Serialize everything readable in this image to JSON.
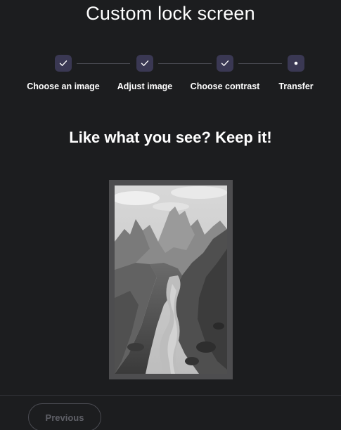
{
  "page": {
    "title": "Custom lock screen",
    "headline": "Like what you see? Keep it!"
  },
  "stepper": {
    "steps": [
      {
        "label": "Choose an image",
        "state": "completed",
        "icon": "check-icon"
      },
      {
        "label": "Adjust image",
        "state": "completed",
        "icon": "check-icon"
      },
      {
        "label": "Choose contrast",
        "state": "completed",
        "icon": "check-icon"
      },
      {
        "label": "Transfer",
        "state": "current",
        "icon": "dot-icon"
      }
    ]
  },
  "preview": {
    "description_icon": "mountain-landscape-image",
    "style": "grayscale"
  },
  "footer": {
    "previous_label": "Previous"
  },
  "colors": {
    "background": "#1c1d1f",
    "step_badge": "#3a3853",
    "frame": "#4d4d4f",
    "disabled_text": "#5e5f66"
  }
}
